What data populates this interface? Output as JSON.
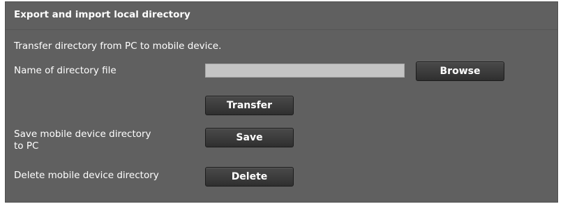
{
  "section": {
    "title": "Export and import local directory",
    "intro": "Transfer directory from PC to mobile device."
  },
  "file_field": {
    "label": "Name of directory file",
    "value": "",
    "browse_label": "Browse"
  },
  "transfer": {
    "button_label": "Transfer"
  },
  "save": {
    "label_line1": "Save mobile device directory",
    "label_line2": "to PC",
    "button_label": "Save"
  },
  "delete": {
    "label": "Delete mobile device directory",
    "button_label": "Delete"
  },
  "colors": {
    "panel_bg": "#606060",
    "input_bg": "#c4c4c4",
    "button_bg": "#3a3a3a",
    "text": "#ffffff"
  }
}
